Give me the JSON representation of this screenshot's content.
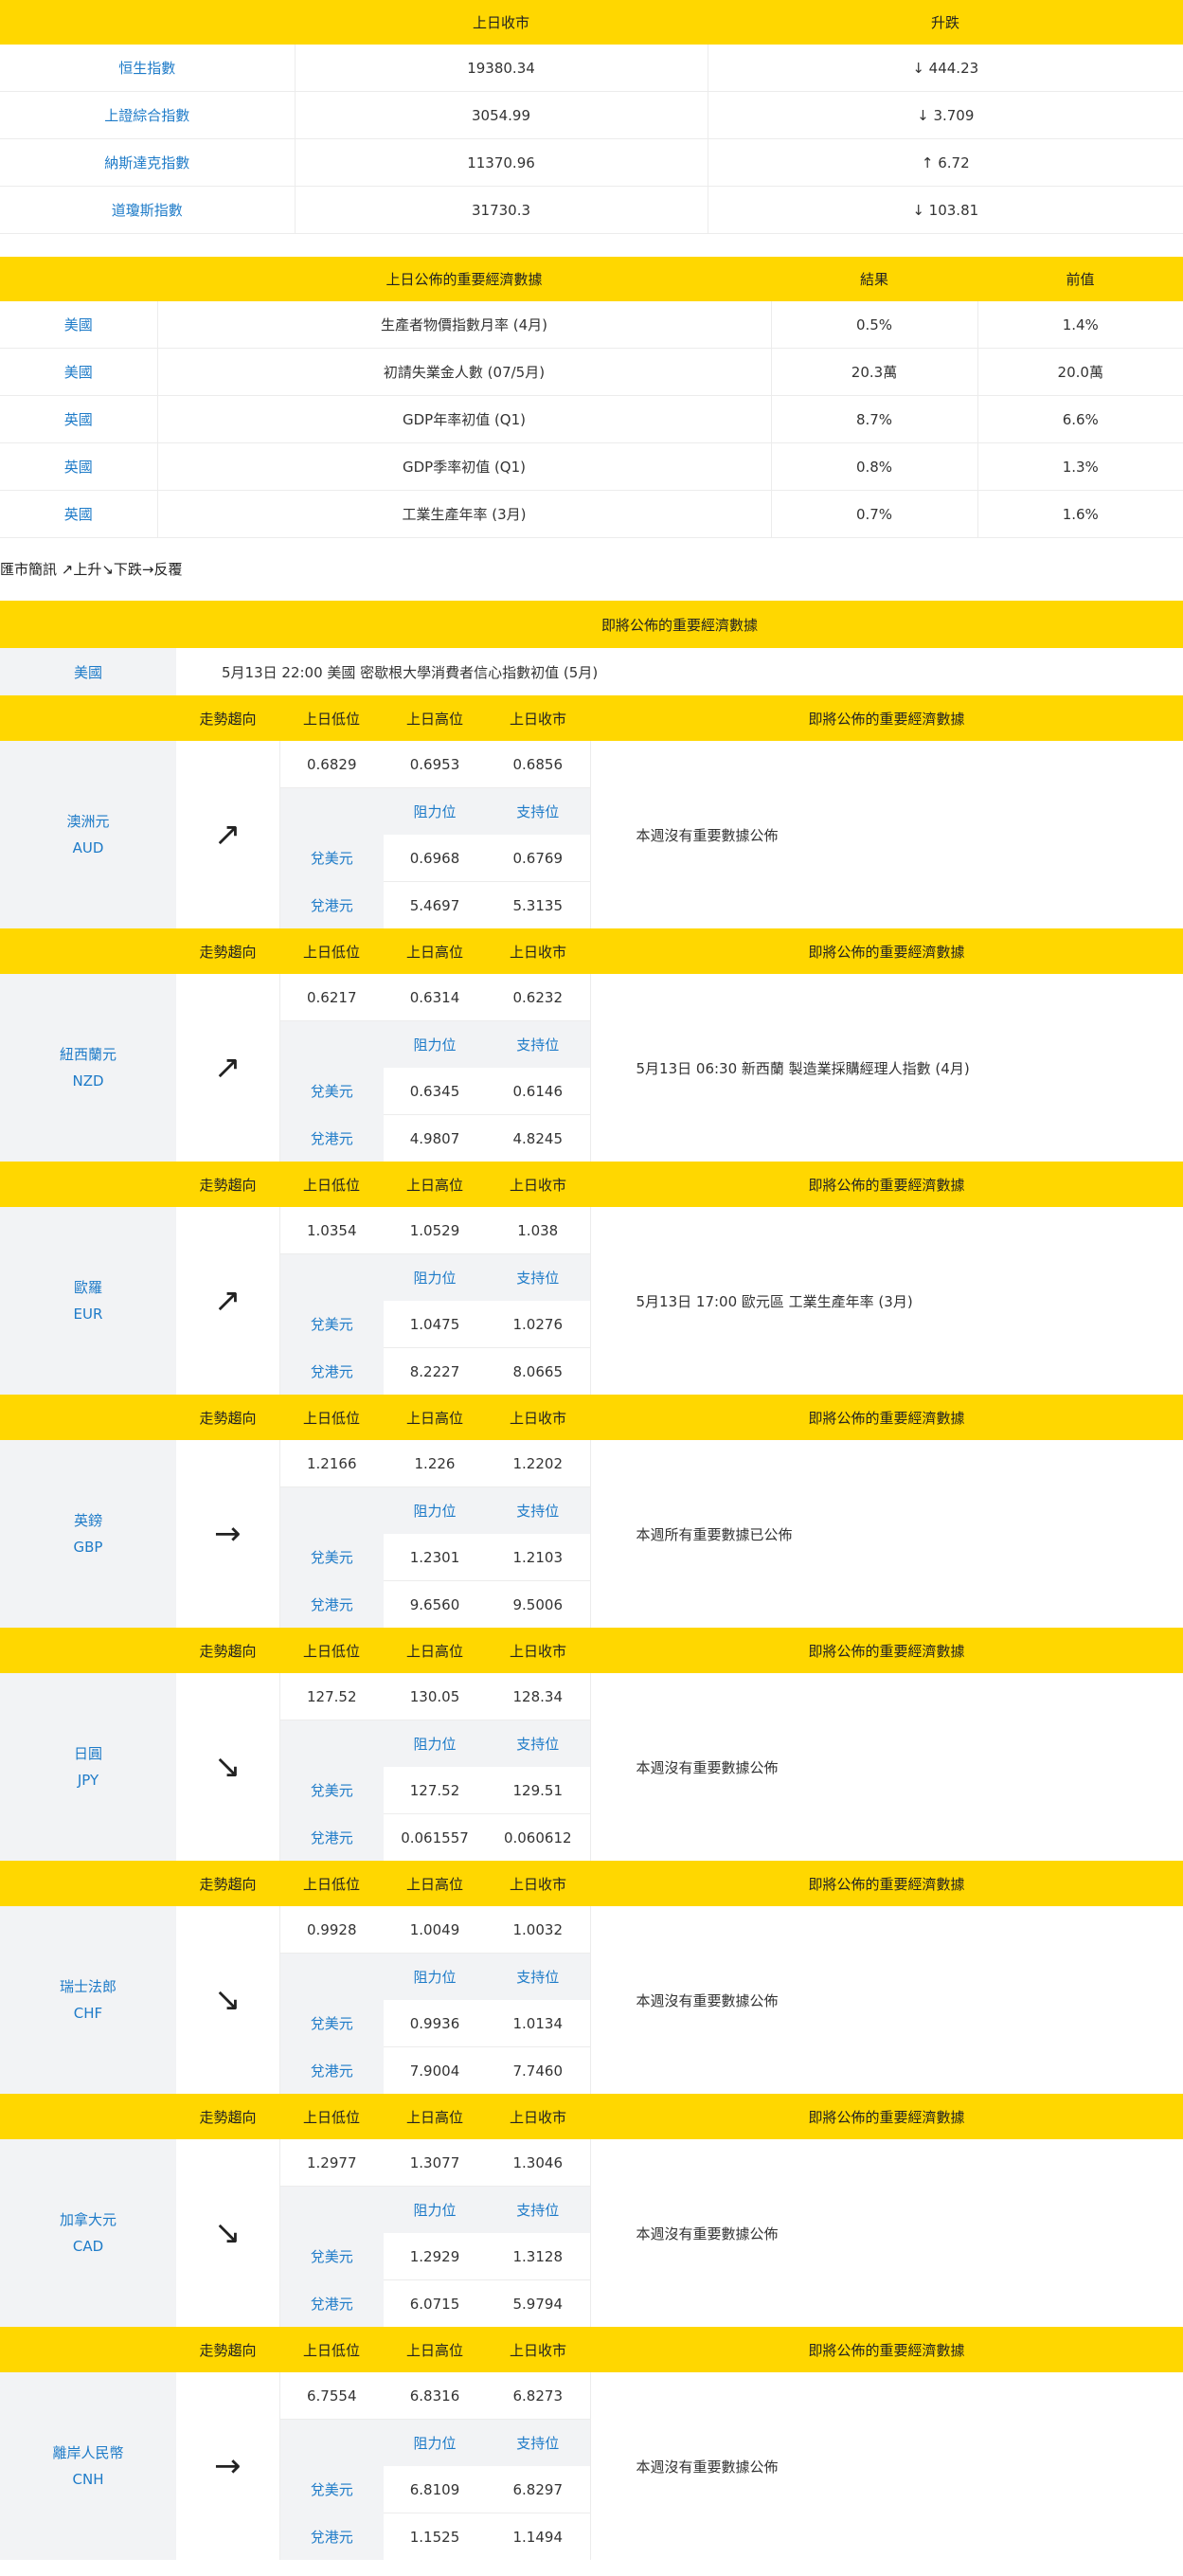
{
  "indices": {
    "headers": [
      "上日收市",
      "升跌"
    ],
    "rows": [
      {
        "name": "恒生指數",
        "close": "19380.34",
        "dir": "↓",
        "change": "444.23"
      },
      {
        "name": "上證綜合指數",
        "close": "3054.99",
        "dir": "↓",
        "change": "3.709"
      },
      {
        "name": "納斯達克指數",
        "close": "11370.96",
        "dir": "↑",
        "change": "6.72"
      },
      {
        "name": "道瓊斯指數",
        "close": "31730.3",
        "dir": "↓",
        "change": "103.81"
      }
    ]
  },
  "economic": {
    "headers": [
      "上日公佈的重要經濟數據",
      "結果",
      "前值"
    ],
    "rows": [
      {
        "country": "美國",
        "item": "生產者物價指數月率 (4月)",
        "result": "0.5%",
        "prev": "1.4%"
      },
      {
        "country": "美國",
        "item": "初請失業金人數 (07/5月)",
        "result": "20.3萬",
        "prev": "20.0萬"
      },
      {
        "country": "英國",
        "item": "GDP年率初值 (Q1)",
        "result": "8.7%",
        "prev": "6.6%"
      },
      {
        "country": "英國",
        "item": "GDP季率初值 (Q1)",
        "result": "0.8%",
        "prev": "1.3%"
      },
      {
        "country": "英國",
        "item": "工業生產年率 (3月)",
        "result": "0.7%",
        "prev": "1.6%"
      }
    ]
  },
  "legend": "匯市簡訊 ↗上升↘下跌→反覆",
  "upcoming": {
    "header": "即將公佈的重要經濟數據",
    "country": "美國",
    "text": "5月13日 22:00  美國 密歇根大學消費者信心指數初值 (5月)"
  },
  "currency_headers": {
    "trend": "走勢趨向",
    "low": "上日低位",
    "high": "上日高位",
    "close": "上日收市",
    "upcoming": "即將公佈的重要經濟數據",
    "resistance": "阻力位",
    "support": "支持位",
    "vs_usd": "兌美元",
    "vs_hkd": "兌港元"
  },
  "currencies": [
    {
      "name": "澳洲元",
      "code": "AUD",
      "arrow": "↗",
      "low": "0.6829",
      "high": "0.6953",
      "close": "0.6856",
      "usd_res": "0.6968",
      "usd_sup": "0.6769",
      "hkd_res": "5.4697",
      "hkd_sup": "5.3135",
      "note": "本週沒有重要數據公佈"
    },
    {
      "name": "紐西蘭元",
      "code": "NZD",
      "arrow": "↗",
      "low": "0.6217",
      "high": "0.6314",
      "close": "0.6232",
      "usd_res": "0.6345",
      "usd_sup": "0.6146",
      "hkd_res": "4.9807",
      "hkd_sup": "4.8245",
      "note": "5月13日 06:30  新西蘭 製造業採購經理人指數 (4月)"
    },
    {
      "name": "歐羅",
      "code": "EUR",
      "arrow": "↗",
      "low": "1.0354",
      "high": "1.0529",
      "close": "1.038",
      "usd_res": "1.0475",
      "usd_sup": "1.0276",
      "hkd_res": "8.2227",
      "hkd_sup": "8.0665",
      "note": "5月13日 17:00  歐元區 工業生產年率 (3月)"
    },
    {
      "name": "英鎊",
      "code": "GBP",
      "arrow": "→",
      "low": "1.2166",
      "high": "1.226",
      "close": "1.2202",
      "usd_res": "1.2301",
      "usd_sup": "1.2103",
      "hkd_res": "9.6560",
      "hkd_sup": "9.5006",
      "note": "本週所有重要數據已公佈"
    },
    {
      "name": "日圓",
      "code": "JPY",
      "arrow": "↘",
      "low": "127.52",
      "high": "130.05",
      "close": "128.34",
      "usd_res": "127.52",
      "usd_sup": "129.51",
      "hkd_res": "0.061557",
      "hkd_sup": "0.060612",
      "note": "本週沒有重要數據公佈"
    },
    {
      "name": "瑞士法郎",
      "code": "CHF",
      "arrow": "↘",
      "low": "0.9928",
      "high": "1.0049",
      "close": "1.0032",
      "usd_res": "0.9936",
      "usd_sup": "1.0134",
      "hkd_res": "7.9004",
      "hkd_sup": "7.7460",
      "note": "本週沒有重要數據公佈"
    },
    {
      "name": "加拿大元",
      "code": "CAD",
      "arrow": "↘",
      "low": "1.2977",
      "high": "1.3077",
      "close": "1.3046",
      "usd_res": "1.2929",
      "usd_sup": "1.3128",
      "hkd_res": "6.0715",
      "hkd_sup": "5.9794",
      "note": "本週沒有重要數據公佈"
    },
    {
      "name": "離岸人民幣",
      "code": "CNH",
      "arrow": "→",
      "low": "6.7554",
      "high": "6.8316",
      "close": "6.8273",
      "usd_res": "6.8109",
      "usd_sup": "6.8297",
      "hkd_res": "1.1525",
      "hkd_sup": "1.1494",
      "note": "本週沒有重要數據公佈"
    }
  ]
}
